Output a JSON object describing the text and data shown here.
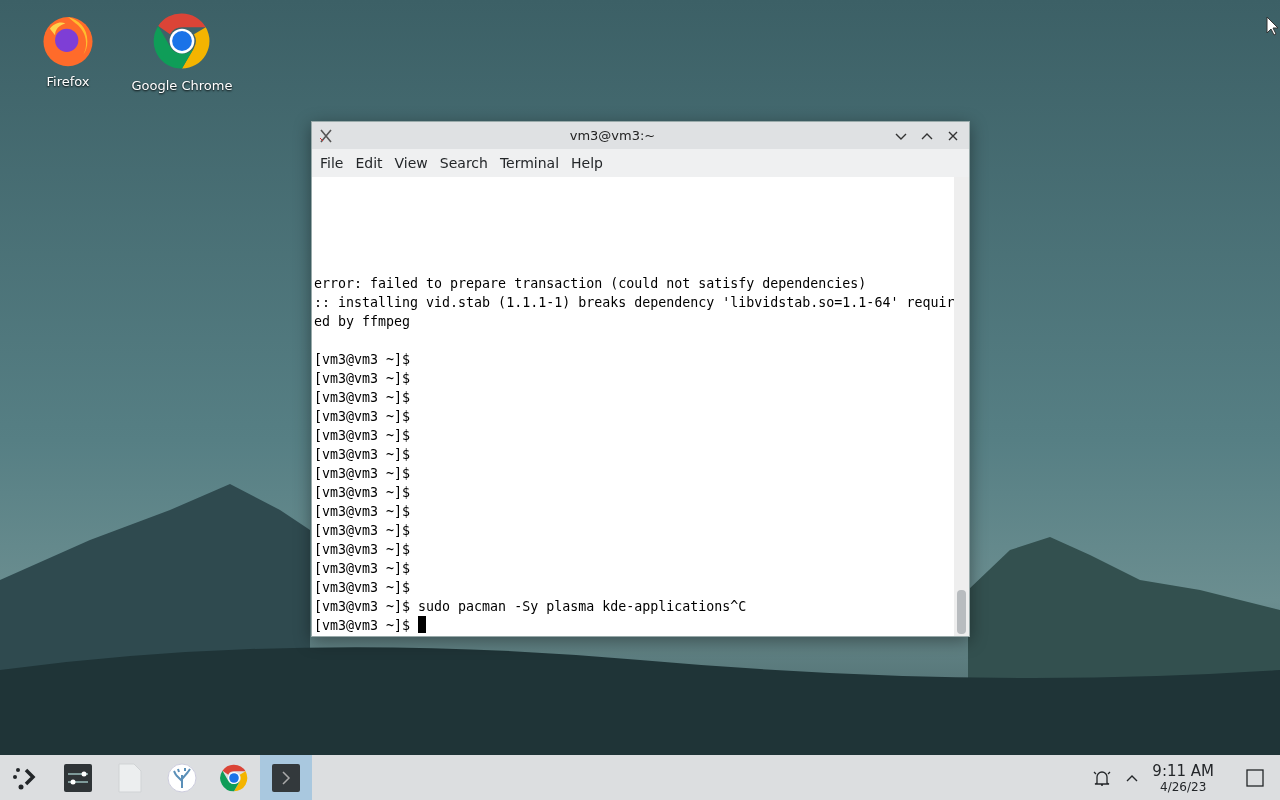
{
  "desktop_icons": [
    {
      "label": "Firefox",
      "kind": "firefox"
    },
    {
      "label": "Google Chrome",
      "kind": "chrome"
    }
  ],
  "window": {
    "title": "vm3@vm3:~",
    "menu": [
      "File",
      "Edit",
      "View",
      "Search",
      "Terminal",
      "Help"
    ],
    "blocks": [
      {
        "lines": [
          {
            "text": "error: failed to prepare transaction (could not satisfy dependencies)",
            "cursor": false
          },
          {
            "text": ":: installing vid.stab (1.1.1-1) breaks dependency 'libvidstab.so=1.1-64' requir",
            "cursor": false
          },
          {
            "text": "ed by ffmpeg",
            "cursor": false
          }
        ]
      },
      {
        "lines": [
          {
            "text": "[vm3@vm3 ~]$",
            "cursor": false
          },
          {
            "text": "[vm3@vm3 ~]$",
            "cursor": false
          },
          {
            "text": "[vm3@vm3 ~]$",
            "cursor": false
          },
          {
            "text": "[vm3@vm3 ~]$",
            "cursor": false
          },
          {
            "text": "[vm3@vm3 ~]$",
            "cursor": false
          },
          {
            "text": "[vm3@vm3 ~]$",
            "cursor": false
          },
          {
            "text": "[vm3@vm3 ~]$",
            "cursor": false
          },
          {
            "text": "[vm3@vm3 ~]$",
            "cursor": false
          },
          {
            "text": "[vm3@vm3 ~]$",
            "cursor": false
          },
          {
            "text": "[vm3@vm3 ~]$",
            "cursor": false
          },
          {
            "text": "[vm3@vm3 ~]$",
            "cursor": false
          },
          {
            "text": "[vm3@vm3 ~]$",
            "cursor": false
          },
          {
            "text": "[vm3@vm3 ~]$",
            "cursor": false
          },
          {
            "text": "[vm3@vm3 ~]$ sudo pacman -Sy plasma kde-applications^C",
            "cursor": false
          },
          {
            "text": "[vm3@vm3 ~]$ ",
            "cursor": true
          }
        ]
      }
    ]
  },
  "taskbar": {
    "items": [
      {
        "kind": "launcher",
        "selected": false
      },
      {
        "kind": "settings",
        "selected": false
      },
      {
        "kind": "files",
        "selected": false
      },
      {
        "kind": "discover",
        "selected": false
      },
      {
        "kind": "chrome",
        "selected": false
      },
      {
        "kind": "terminal",
        "selected": true
      }
    ],
    "time": "9:11 AM",
    "date": "4/26/23"
  }
}
